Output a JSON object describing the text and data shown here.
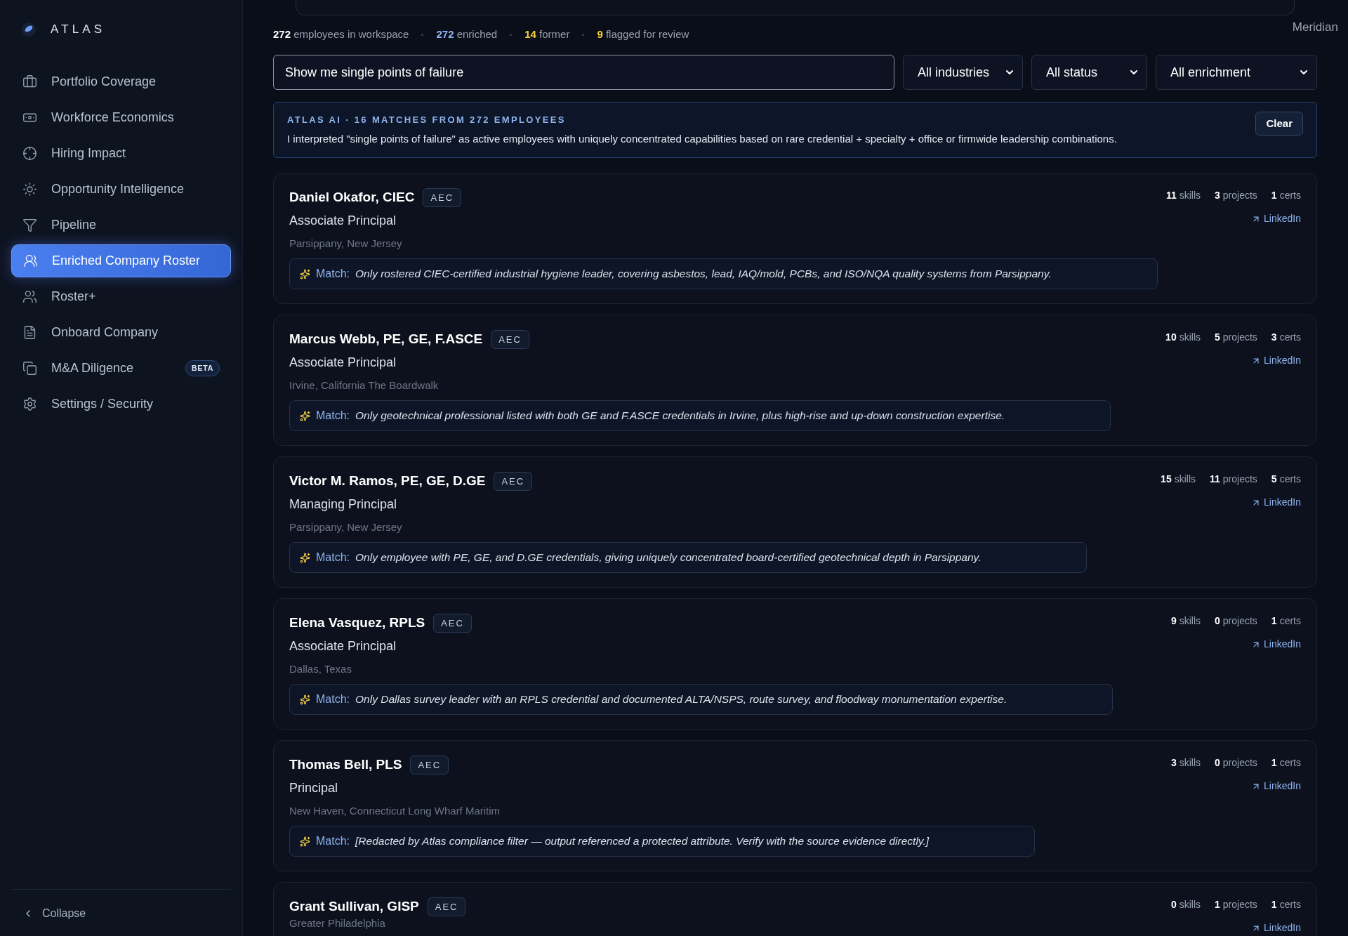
{
  "brand": {
    "name": "ATLAS"
  },
  "sidebar": {
    "items": [
      {
        "label": "Portfolio Coverage",
        "selected": false
      },
      {
        "label": "Workforce Economics",
        "selected": false
      },
      {
        "label": "Hiring Impact",
        "selected": false
      },
      {
        "label": "Opportunity Intelligence",
        "selected": false
      },
      {
        "label": "Pipeline",
        "selected": false
      },
      {
        "label": "Enriched Company Roster",
        "selected": true
      },
      {
        "label": "Roster+",
        "selected": false
      },
      {
        "label": "Onboard Company",
        "selected": false
      },
      {
        "label": "M&A Diligence",
        "selected": false,
        "badge": "BETA"
      },
      {
        "label": "Settings / Security",
        "selected": false
      }
    ],
    "collapse": "Collapse"
  },
  "workspace": "Meridian",
  "stats": [
    {
      "value": "272",
      "label": "employees in workspace",
      "color": "#ffffff"
    },
    {
      "value": "272",
      "label": "enriched",
      "color": "#8fb4ef"
    },
    {
      "value": "14",
      "label": "former",
      "color": "#f5d033"
    },
    {
      "value": "9",
      "label": "flagged for review",
      "color": "#f5d033"
    }
  ],
  "search": {
    "value": "Show me single points of failure"
  },
  "filters": [
    "All industries",
    "All status",
    "All enrichment"
  ],
  "ai_panel": {
    "heading": "ATLAS AI · 16 MATCHES FROM 272 EMPLOYEES",
    "text": "I interpreted \"single points of failure\" as active employees with uniquely concentrated capabilities based on rare credential + specialty + office or firmwide leadership combinations.",
    "button": "Clear"
  },
  "cards": [
    {
      "name": "Daniel Okafor, CIEC",
      "tag": "AEC",
      "title": "Associate Principal",
      "location": "Parsippany, New Jersey",
      "counts": [
        {
          "count": "11",
          "unit": "skills"
        },
        {
          "count": "3",
          "unit": "projects"
        },
        {
          "count": "1",
          "unit": "certs"
        }
      ],
      "link": "LinkedIn",
      "match_label": "Match:",
      "match": "Only rostered CIEC-certified industrial hygiene leader, covering asbestos, lead, IAQ/mold, PCBs, and ISO/NQA quality systems from Parsippany."
    },
    {
      "name": "Marcus Webb, PE, GE, F.ASCE",
      "tag": "AEC",
      "title": "Associate Principal",
      "location": "Irvine, California The Boardwalk",
      "counts": [
        {
          "count": "10",
          "unit": "skills"
        },
        {
          "count": "5",
          "unit": "projects"
        },
        {
          "count": "3",
          "unit": "certs"
        }
      ],
      "link": "LinkedIn",
      "match_label": "Match:",
      "match": "Only geotechnical professional listed with both GE and F.ASCE credentials in Irvine, plus high-rise and up-down construction expertise."
    },
    {
      "name": "Victor M. Ramos, PE, GE, D.GE",
      "tag": "AEC",
      "title": "Managing Principal",
      "location": "Parsippany, New Jersey",
      "counts": [
        {
          "count": "15",
          "unit": "skills"
        },
        {
          "count": "11",
          "unit": "projects"
        },
        {
          "count": "5",
          "unit": "certs"
        }
      ],
      "link": "LinkedIn",
      "match_label": "Match:",
      "match": "Only employee with PE, GE, and D.GE credentials, giving uniquely concentrated board-certified geotechnical depth in Parsippany."
    },
    {
      "name": "Elena Vasquez, RPLS",
      "tag": "AEC",
      "title": "Associate Principal",
      "location": "Dallas, Texas",
      "counts": [
        {
          "count": "9",
          "unit": "skills"
        },
        {
          "count": "0",
          "unit": "projects"
        },
        {
          "count": "1",
          "unit": "certs"
        }
      ],
      "link": "LinkedIn",
      "match_label": "Match:",
      "match": "Only Dallas survey leader with an RPLS credential and documented ALTA/NSPS, route survey, and floodway monumentation expertise."
    },
    {
      "name": "Thomas Bell, PLS",
      "tag": "AEC",
      "title": "Principal",
      "location": "New Haven, Connecticut Long Wharf Maritim",
      "counts": [
        {
          "count": "3",
          "unit": "skills"
        },
        {
          "count": "0",
          "unit": "projects"
        },
        {
          "count": "1",
          "unit": "certs"
        }
      ],
      "link": "LinkedIn",
      "match_label": "Match:",
      "match": "[Redacted by Atlas compliance filter — output referenced a protected attribute. Verify with the source evidence directly.]"
    },
    {
      "name": "Grant Sullivan, GISP",
      "tag": "AEC",
      "location": "Greater Philadelphia",
      "counts": [
        {
          "count": "0",
          "unit": "skills"
        },
        {
          "count": "1",
          "unit": "projects"
        },
        {
          "count": "1",
          "unit": "certs"
        }
      ],
      "link": "LinkedIn"
    }
  ]
}
